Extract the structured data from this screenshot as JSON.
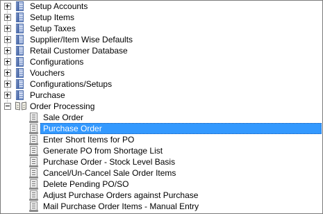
{
  "tree": {
    "top_level": [
      {
        "label": "Setup Accounts",
        "expander": "+",
        "icon": "book-icon"
      },
      {
        "label": "Setup Items",
        "expander": "+",
        "icon": "book-icon"
      },
      {
        "label": "Setup Taxes",
        "expander": "+",
        "icon": "book-icon"
      },
      {
        "label": "Supplier/Item Wise Defaults",
        "expander": "+",
        "icon": "book-icon"
      },
      {
        "label": "Retail Customer Database",
        "expander": "+",
        "icon": "book-icon"
      },
      {
        "label": "Configurations",
        "expander": "+",
        "icon": "book-icon"
      },
      {
        "label": "Vouchers",
        "expander": "+",
        "icon": "book-icon"
      },
      {
        "label": "Configurations/Setups",
        "expander": "+",
        "icon": "book-icon"
      },
      {
        "label": "Purchase",
        "expander": "+",
        "icon": "book-icon"
      },
      {
        "label": "Order Processing",
        "expander": "-",
        "icon": "open-book-icon"
      }
    ],
    "order_processing_children": [
      {
        "label": "Sale Order",
        "icon": "page-icon",
        "selected": false
      },
      {
        "label": "Purchase Order",
        "icon": "page-icon",
        "selected": true
      },
      {
        "label": "Enter Short Items for PO",
        "icon": "page-icon",
        "selected": false
      },
      {
        "label": "Generate PO from Shortage List",
        "icon": "page-icon",
        "selected": false
      },
      {
        "label": "Purchase Order - Stock Level Basis",
        "icon": "page-icon",
        "selected": false
      },
      {
        "label": "Cancel/Un-Cancel Sale Order Items",
        "icon": "page-icon",
        "selected": false
      },
      {
        "label": "Delete Pending PO/SO",
        "icon": "page-icon",
        "selected": false
      },
      {
        "label": "Adjust Purchase Orders against Purchase",
        "icon": "page-icon",
        "selected": false
      },
      {
        "label": "Mail Purchase Order Items - Manual Entry",
        "icon": "page-icon",
        "selected": false
      }
    ]
  },
  "colors": {
    "selection": "#3399ff",
    "selection_text": "#ffffff",
    "border": "#7a7a7a"
  }
}
